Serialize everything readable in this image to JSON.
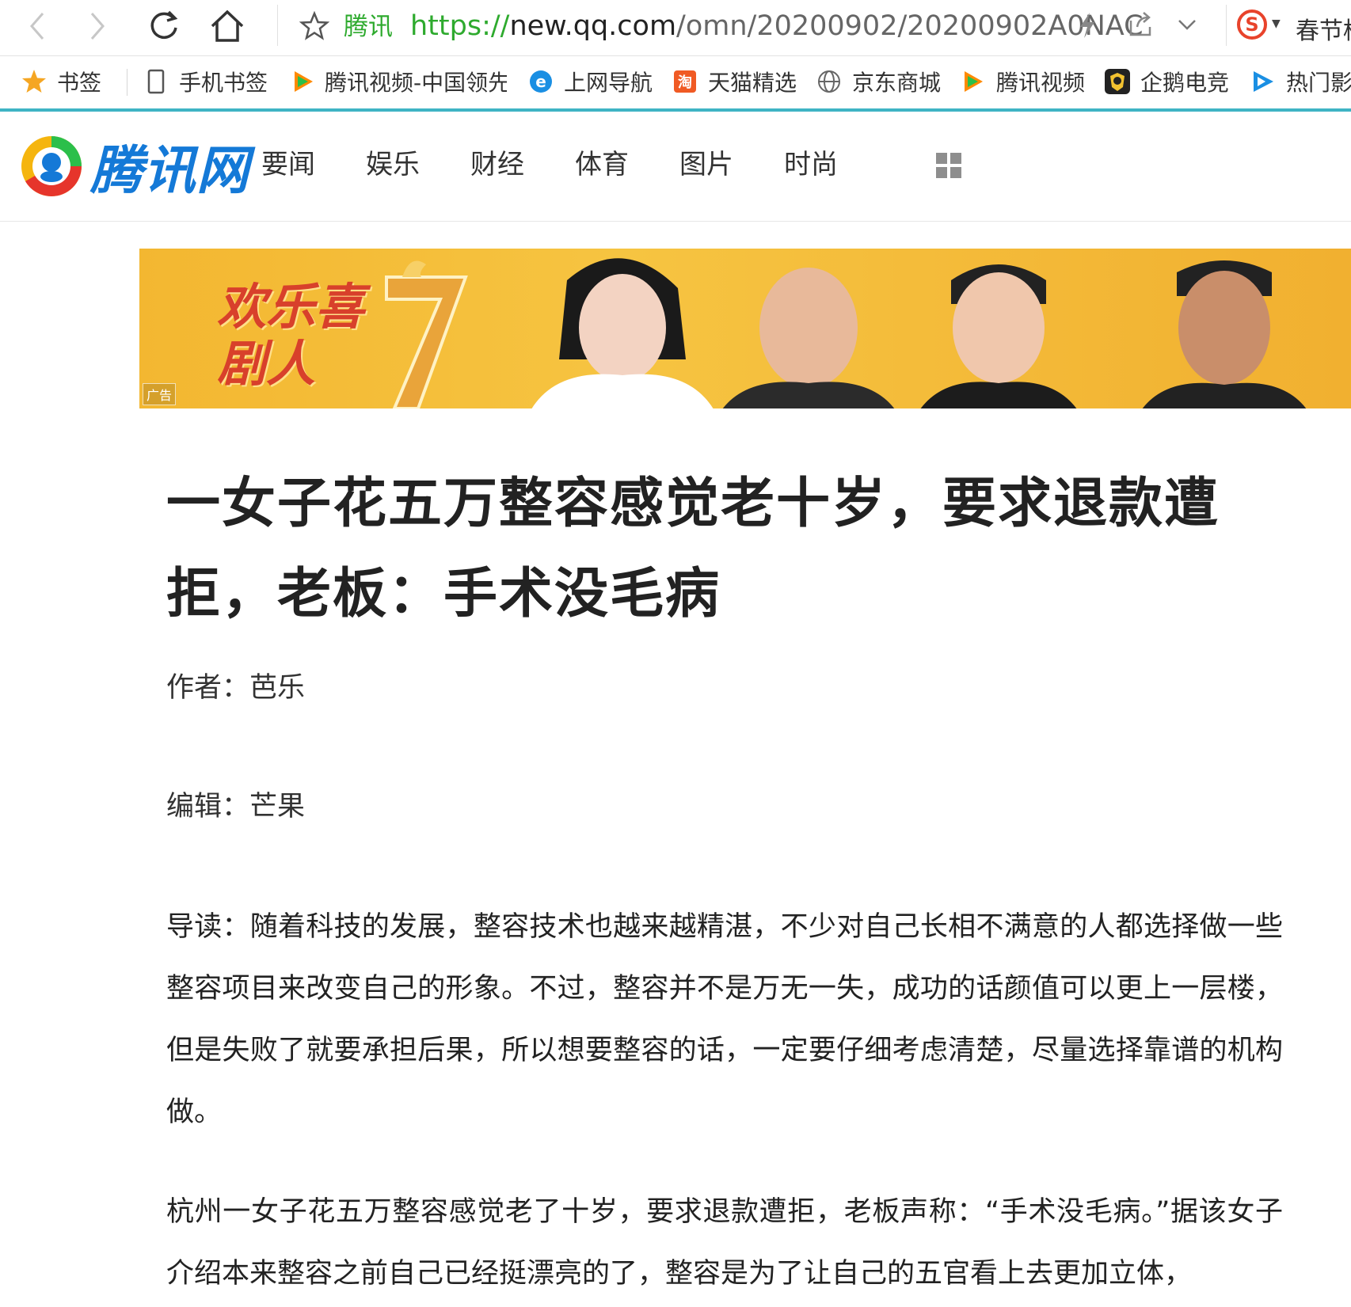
{
  "browser": {
    "site_name": "腾讯",
    "url": {
      "protocol": "https://",
      "host": "new.qq.com",
      "path": "/omn/20200902/20200902A0NAC"
    },
    "right_text": "春节档",
    "bookmarks": [
      {
        "label": "书签",
        "icon": "star-icon"
      },
      {
        "label": "手机书签",
        "icon": "phone-icon"
      },
      {
        "label": "腾讯视频-中国领先",
        "icon": "tencent-video-icon"
      },
      {
        "label": "上网导航",
        "icon": "ie-icon"
      },
      {
        "label": "天猫精选",
        "icon": "tmall-icon"
      },
      {
        "label": "京东商城",
        "icon": "globe-icon"
      },
      {
        "label": "腾讯视频",
        "icon": "tencent-video-icon"
      },
      {
        "label": "企鹅电竞",
        "icon": "penguin-esports-icon"
      },
      {
        "label": "热门影",
        "icon": "play-icon"
      }
    ],
    "colors": {
      "accent_green": "#2eaa2e",
      "bookmark_bar_border": "#3fb4c4"
    }
  },
  "site": {
    "logo_text": "腾讯网",
    "nav": [
      "要闻",
      "娱乐",
      "财经",
      "体育",
      "图片",
      "时尚"
    ],
    "brand_color": "#1479d7"
  },
  "ad": {
    "title": "欢乐喜剧人",
    "tag": "广告",
    "seven": "7"
  },
  "article": {
    "title": "一女子花五万整容感觉老十岁，要求退款遭拒，老板：手术没毛病",
    "author": "作者：芭乐",
    "editor": "编辑：芒果",
    "paragraphs": [
      "导读：随着科技的发展，整容技术也越来越精湛，不少对自己长相不满意的人都选择做一些整容项目来改变自己的形象。不过，整容并不是万无一失，成功的话颜值可以更上一层楼，但是失败了就要承担后果，所以想要整容的话，一定要仔细考虑清楚，尽量选择靠谱的机构做。",
      "杭州一女子花五万整容感觉老了十岁，要求退款遭拒，老板声称：“手术没毛病。”据该女子介绍本来整容之前自己已经挺漂亮的了，整容是为了让自己的五官看上去更加立体，"
    ]
  }
}
